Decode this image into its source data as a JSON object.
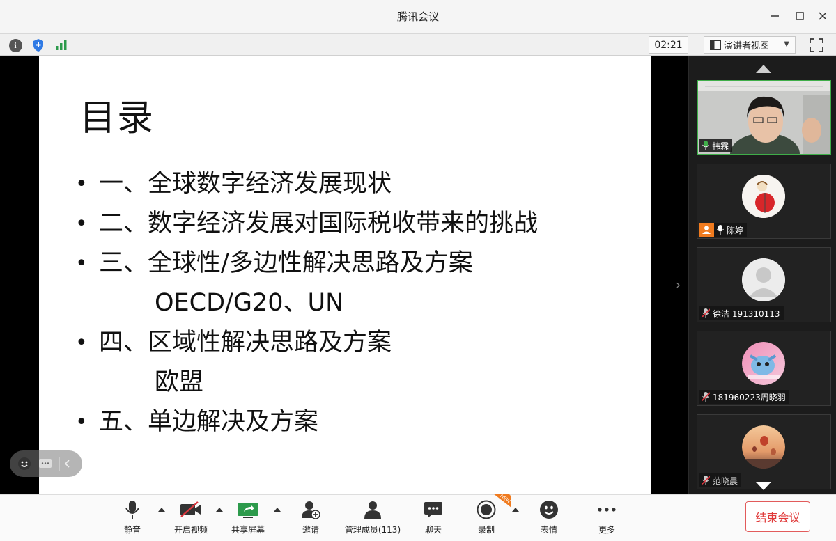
{
  "window": {
    "title": "腾讯会议"
  },
  "toolbar": {
    "timer": "02:21",
    "view_label": "演讲者视图"
  },
  "slide": {
    "title": "目录",
    "items": [
      {
        "text": "一、全球数字经济发展现状"
      },
      {
        "text": "二、数字经济发展对国际税收带来的挑战"
      },
      {
        "text": "三、全球性/多边性解决思路及方案",
        "sub": "OECD/G20、UN"
      },
      {
        "text": "四、区域性解决思路及方案",
        "sub": "欧盟"
      },
      {
        "text": "五、单边解决及方案"
      }
    ]
  },
  "participants": [
    {
      "name": "韩霖",
      "mic": "on",
      "video": true
    },
    {
      "name": "陈婷",
      "mic": "on",
      "video": false,
      "host_icon": true
    },
    {
      "name": "徐洁 191310113",
      "mic": "muted",
      "video": false
    },
    {
      "name": "181960223周晓羽",
      "mic": "muted",
      "video": false
    },
    {
      "name": "范晓晨",
      "mic": "muted",
      "video": false
    }
  ],
  "bottom": {
    "mute": "静音",
    "video": "开启视频",
    "share": "共享屏幕",
    "invite": "邀请",
    "members": "管理成员(113)",
    "chat": "聊天",
    "record": "录制",
    "emoji": "表情",
    "more": "更多",
    "end": "结束会议",
    "new_badge": "NEW"
  },
  "colors": {
    "accent_green": "#3fae49",
    "end_red": "#e03a3a",
    "shield_blue": "#2f7ae5",
    "video_off_red": "#d9363e",
    "share_green": "#2c9a4b"
  }
}
